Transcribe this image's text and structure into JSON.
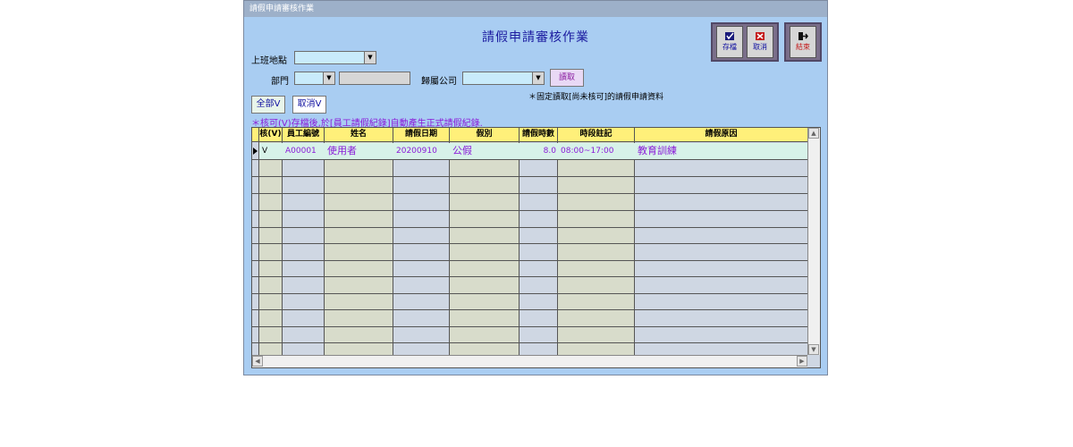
{
  "window": {
    "title": "請假申請審核作業"
  },
  "header": {
    "title": "請假申請審核作業"
  },
  "toolbar": {
    "save_label": "存檔",
    "cancel_label": "取消",
    "exit_label": "結束"
  },
  "filters": {
    "location_label": "上班地點",
    "location_value": "",
    "dept_label": "部門",
    "dept_value": "",
    "dept_name_value": "",
    "company_label": "歸屬公司",
    "company_value": "",
    "read_button": "讀取",
    "read_note": "＊固定讀取[尚未核可]的請假申請資料"
  },
  "actions": {
    "select_all": "全部V",
    "cancel_v": "取消V",
    "note": "＊核可(V)存檔後,於[員工請假紀錄]自動產生正式請假紀錄."
  },
  "grid": {
    "columns": [
      "核(V)",
      "員工編號",
      "姓名",
      "請假日期",
      "假別",
      "請假時數",
      "時段註記",
      "請假原因"
    ],
    "rows": [
      [
        "V",
        "A00001",
        "使用者",
        "20200910",
        "公假",
        "8.0",
        "08:00~17:00",
        "教育訓練"
      ]
    ]
  },
  "colors": {
    "window_bg": "#a9cdf2",
    "header_bg": "#fff07a",
    "accent_text": "#8a1bd8"
  }
}
